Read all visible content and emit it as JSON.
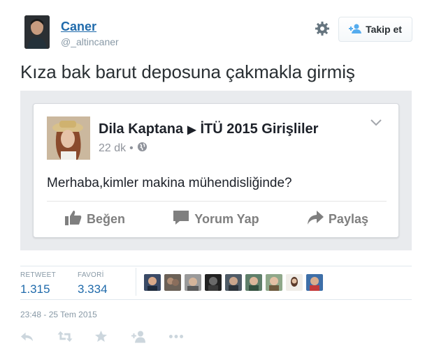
{
  "author": {
    "name": "Caner",
    "handle": "@_altincaner"
  },
  "follow": {
    "label": "Takip et"
  },
  "tweet": {
    "text": "Kıza bak barut deposuna çakmakla girmiş"
  },
  "embedded_post": {
    "author": "Dila Kaptana",
    "group": "İTÜ 2015 Girişliler",
    "time": "22 dk",
    "body": "Merhaba,kimler makina mühendisliğinde?",
    "actions": [
      "Beğen",
      "Yorum Yap",
      "Paylaş"
    ]
  },
  "stats": {
    "retweet_label": "RETWEET",
    "retweet_count": "1.315",
    "favorite_label": "FAVORİ",
    "favorite_count": "3.334"
  },
  "timestamp": "23:48 - 25 Tem 2015",
  "colors": {
    "link": "#1f6aab",
    "muted": "#8899a6",
    "fb_bg": "#e9ebee",
    "fb_icon": "#7f7f7f"
  },
  "icons": [
    "gear-icon",
    "add-user-icon",
    "like-icon",
    "comment-icon",
    "share-icon",
    "reply-icon",
    "retweet-icon",
    "favorite-icon",
    "follow-icon",
    "more-icon"
  ]
}
